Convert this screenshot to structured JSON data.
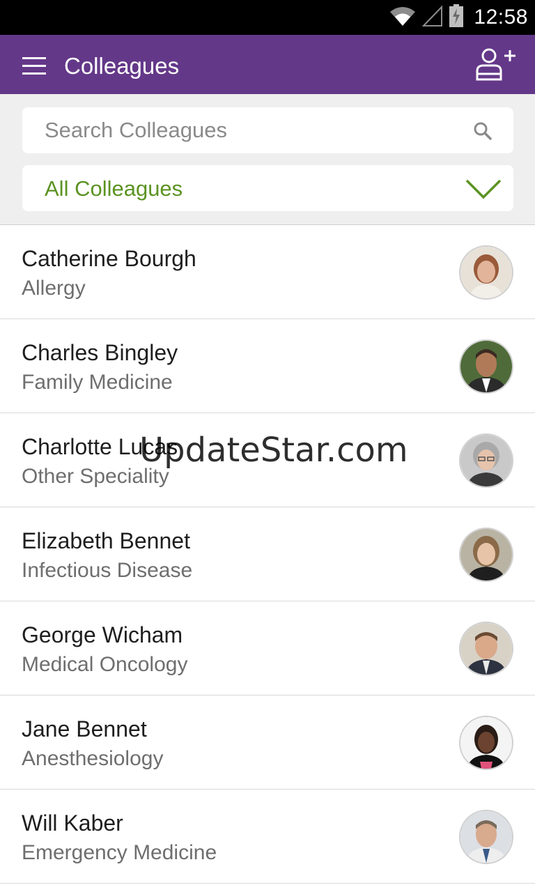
{
  "status_bar": {
    "time": "12:58",
    "icons": [
      "wifi-icon",
      "cellular-signal-icon",
      "battery-charging-icon"
    ]
  },
  "app_bar": {
    "title": "Colleagues",
    "icons": [
      "menu-icon",
      "add-colleague-icon"
    ],
    "color": "#643889"
  },
  "search": {
    "placeholder": "Search Colleagues",
    "value": ""
  },
  "group_filter": {
    "selected": "All Colleagues",
    "color": "#5b9322"
  },
  "colleagues": [
    {
      "name": "Catherine Bourgh",
      "specialty": "Allergy"
    },
    {
      "name": "Charles Bingley",
      "specialty": "Family Medicine"
    },
    {
      "name": "Charlotte Lucas",
      "specialty": "Other Speciality"
    },
    {
      "name": "Elizabeth Bennet",
      "specialty": "Infectious Disease"
    },
    {
      "name": "George Wicham",
      "specialty": "Medical Oncology"
    },
    {
      "name": "Jane Bennet",
      "specialty": "Anesthesiology"
    },
    {
      "name": "Will Kaber",
      "specialty": "Emergency Medicine"
    }
  ],
  "watermark": "UpdateStar.com"
}
